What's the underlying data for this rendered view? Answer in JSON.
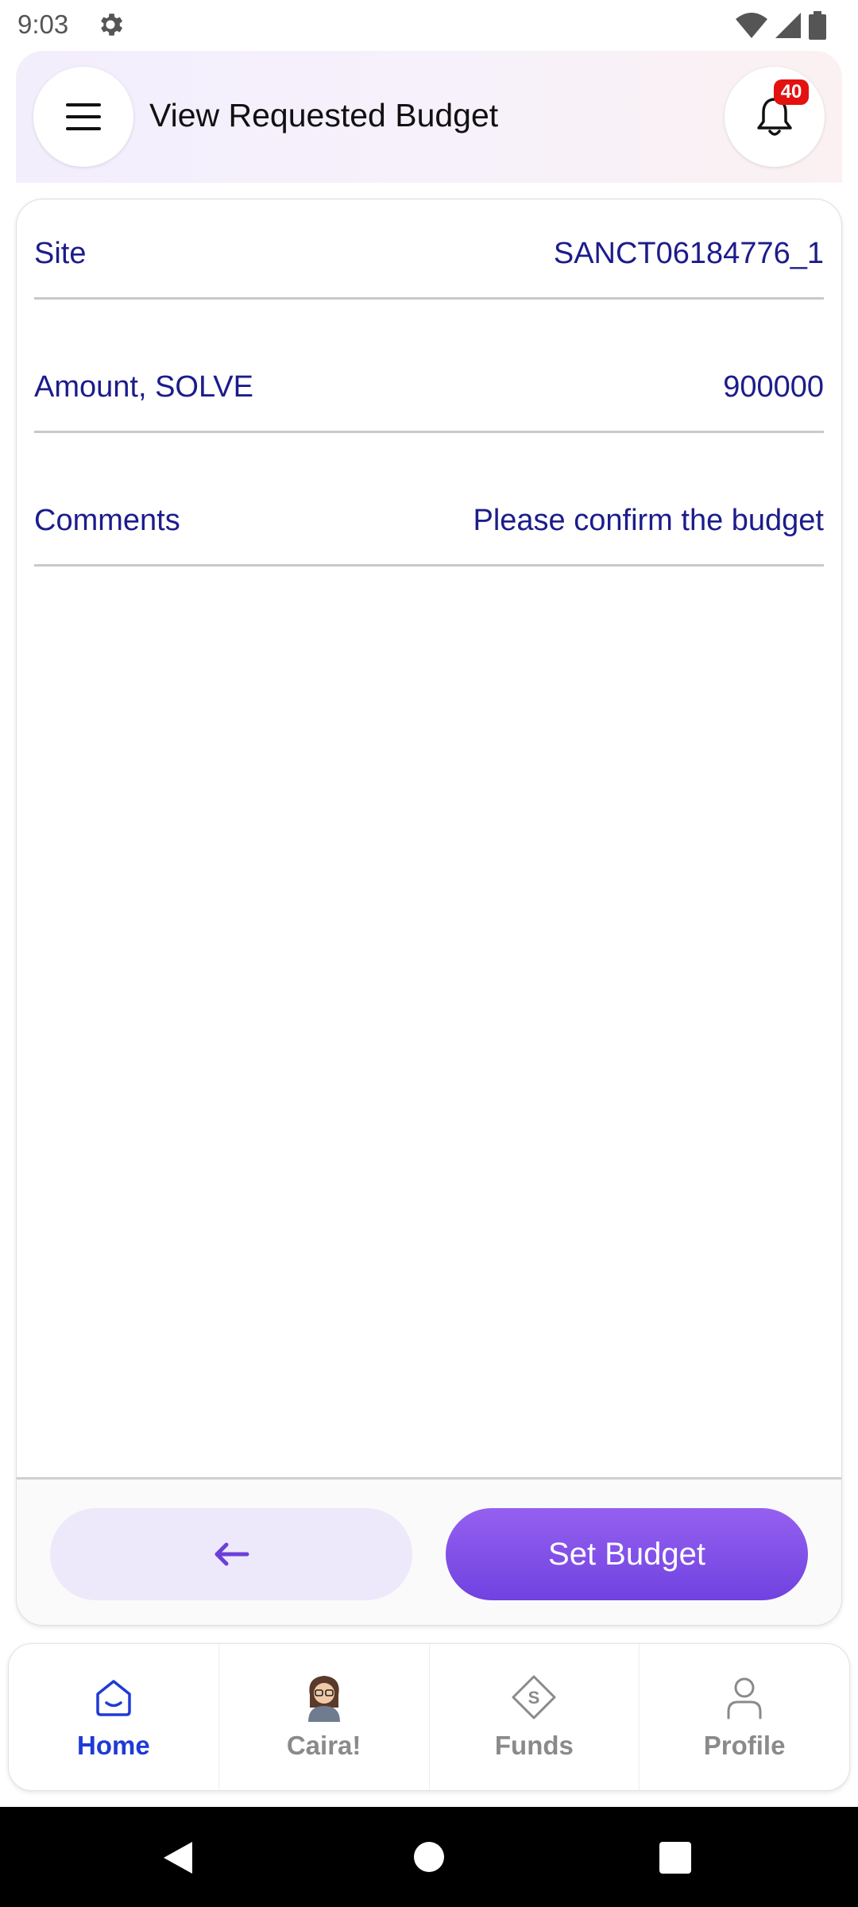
{
  "status": {
    "time": "9:03",
    "icons": [
      "gear-icon",
      "wifi-icon",
      "signal-icon",
      "battery-icon"
    ]
  },
  "header": {
    "title": "View Requested Budget",
    "notification_count": "40",
    "menu_icon": "hamburger-menu-icon",
    "bell_icon": "bell-icon"
  },
  "details": {
    "site": {
      "label": "Site",
      "value": "SANCT06184776_1"
    },
    "amount": {
      "label": "Amount, SOLVE",
      "value": "900000"
    },
    "comments": {
      "label": "Comments",
      "value": "Please confirm the budget"
    }
  },
  "actions": {
    "back_icon": "arrow-left-icon",
    "set_budget_label": "Set Budget"
  },
  "bottom_nav": {
    "home": "Home",
    "caira": "Caira!",
    "funds": "Funds",
    "profile": "Profile",
    "active": "Home"
  },
  "colors": {
    "accent": "#7042e0",
    "text_primary": "#1c1c8c",
    "nav_active": "#1f3ad6",
    "badge": "#e41111"
  }
}
